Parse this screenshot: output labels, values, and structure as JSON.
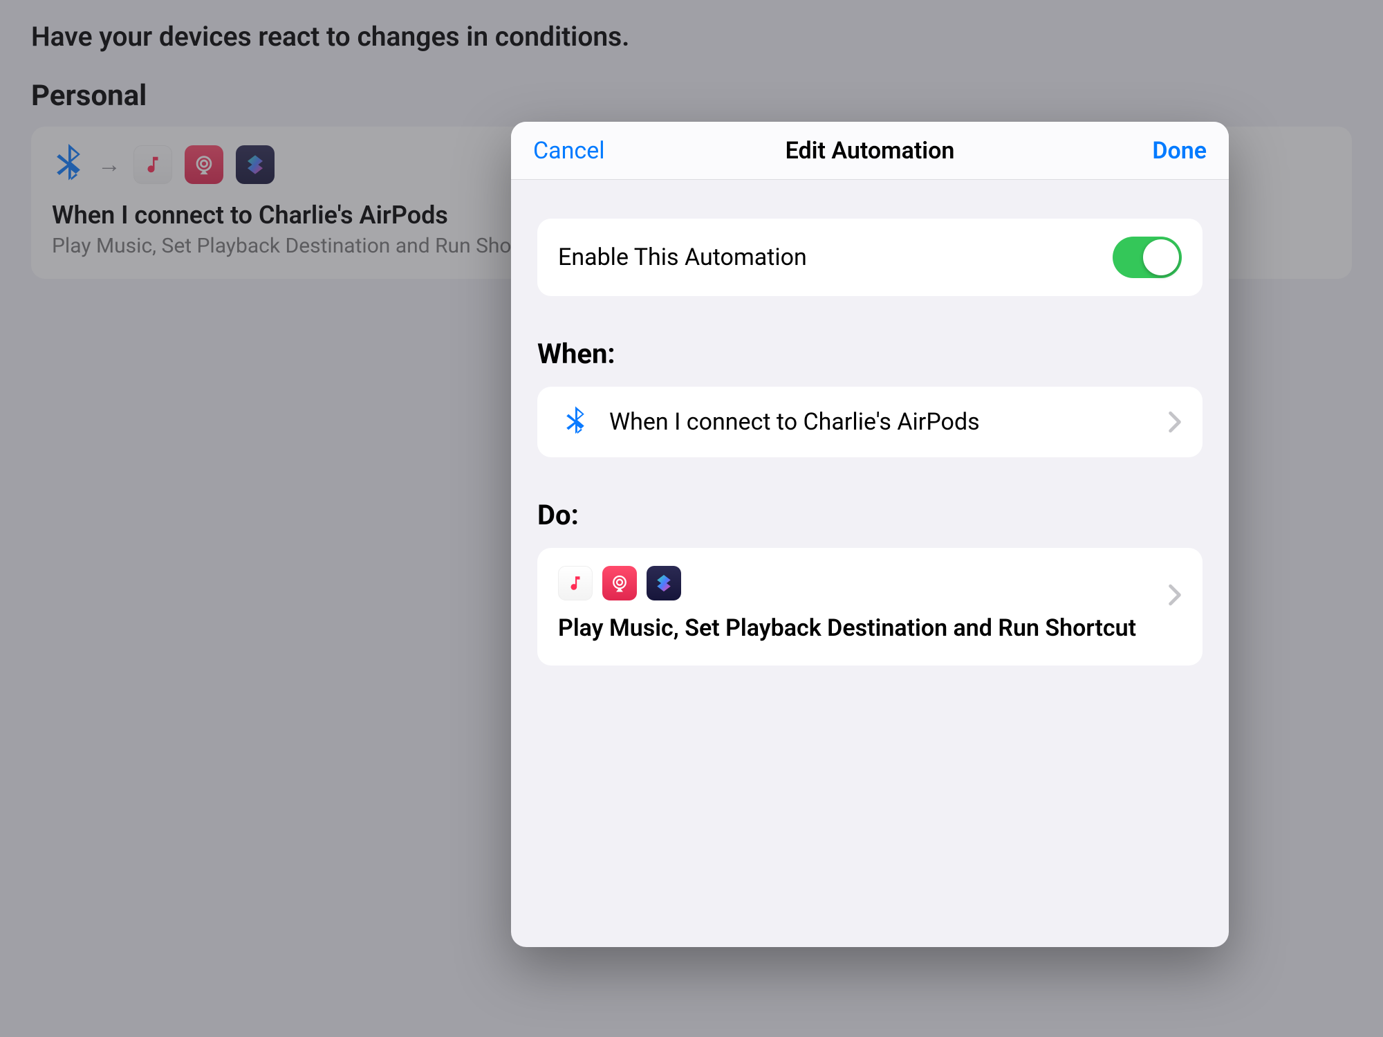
{
  "background": {
    "subtitle": "Have your devices react to changes in conditions.",
    "section_label": "Personal",
    "card": {
      "title": "When I connect to Charlie's AirPods",
      "subtitle": "Play Music, Set Playback Destination and Run Shortcut"
    }
  },
  "modal": {
    "cancel_label": "Cancel",
    "title": "Edit Automation",
    "done_label": "Done",
    "enable_row_label": "Enable This Automation",
    "enable_toggle_on": true,
    "when_heading": "When:",
    "when_text": "When I connect to Charlie's AirPods",
    "do_heading": "Do:",
    "do_text": "Play Music, Set Playback Destination and Run Shortcut"
  },
  "icons": {
    "bluetooth": "bluetooth-icon",
    "music": "music-icon",
    "airplay": "airplay-icon",
    "shortcuts": "shortcuts-icon",
    "arrow": "arrow-right-icon",
    "chevron": "chevron-right-icon"
  }
}
